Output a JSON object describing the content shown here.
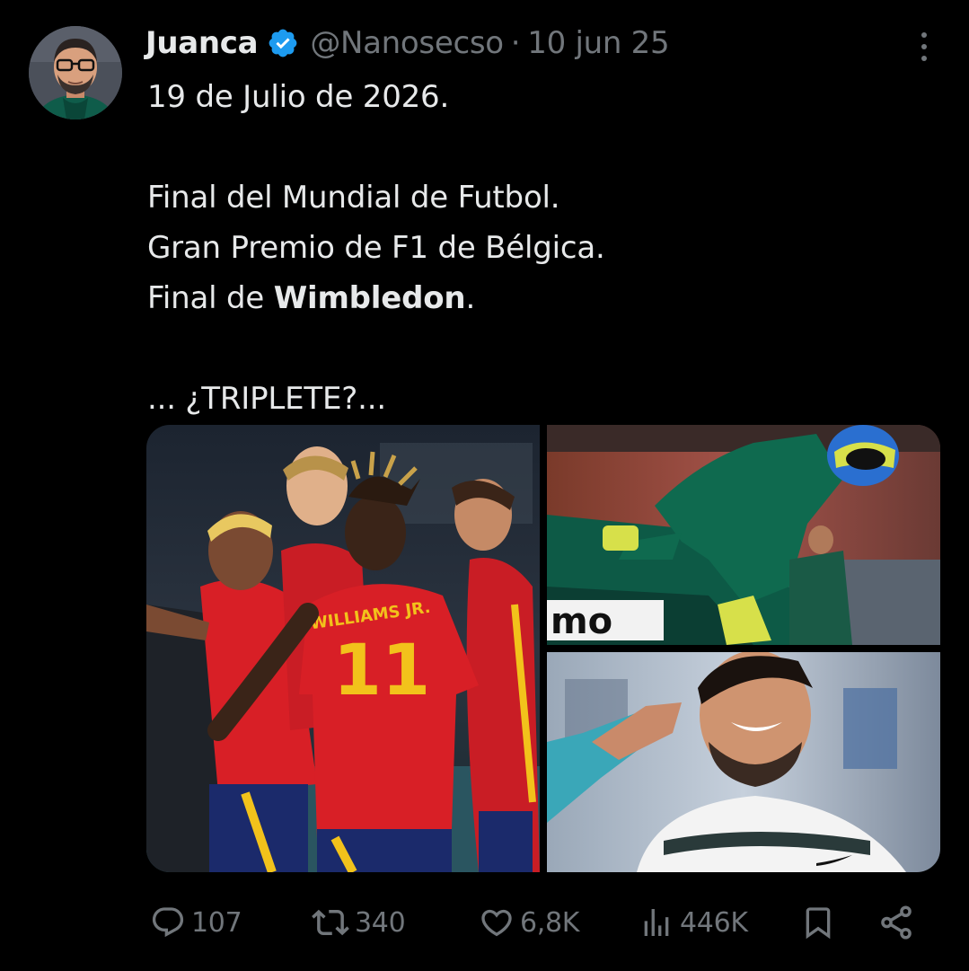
{
  "tweet": {
    "display_name": "Juanca",
    "verified": true,
    "handle": "@Nanosecso",
    "separator": "·",
    "date": "10 jun 25",
    "lines": {
      "l1": "19 de Julio de 2026.",
      "l2": "Final del Mundial de Futbol.",
      "l3": "Gran Premio de F1 de Bélgica.",
      "l4_prefix": "Final de ",
      "l4_bold": "Wimbledon",
      "l4_suffix": ".",
      "l5": "... ¿TRIPLETE?..."
    },
    "media": {
      "image_1": "spain-football-players-celebrating",
      "image_1_jersey_name": "WILLIAMS JR.",
      "image_1_jersey_number": "11",
      "image_2": "aston-martin-f1-driver-climbing-out-of-car",
      "image_2_car_text": "mo",
      "image_3": "tennis-player-smiling-finger-to-ear"
    },
    "stats": {
      "replies": "107",
      "retweets": "340",
      "likes": "6,8K",
      "views": "446K"
    }
  },
  "colors": {
    "background": "#000000",
    "primary_text": "#e7e9ea",
    "secondary_text": "#71767b",
    "verified_blue": "#1d9bf0",
    "spain_red": "#d81f26",
    "spain_yellow": "#f7c81e",
    "aston_green": "#0d5a46"
  },
  "icons": {
    "reply": "reply-icon",
    "retweet": "retweet-icon",
    "like": "heart-icon",
    "views": "views-bar-icon",
    "bookmark": "bookmark-icon",
    "share": "share-icon",
    "more": "more-dots-icon",
    "verified": "verified-badge-icon"
  }
}
